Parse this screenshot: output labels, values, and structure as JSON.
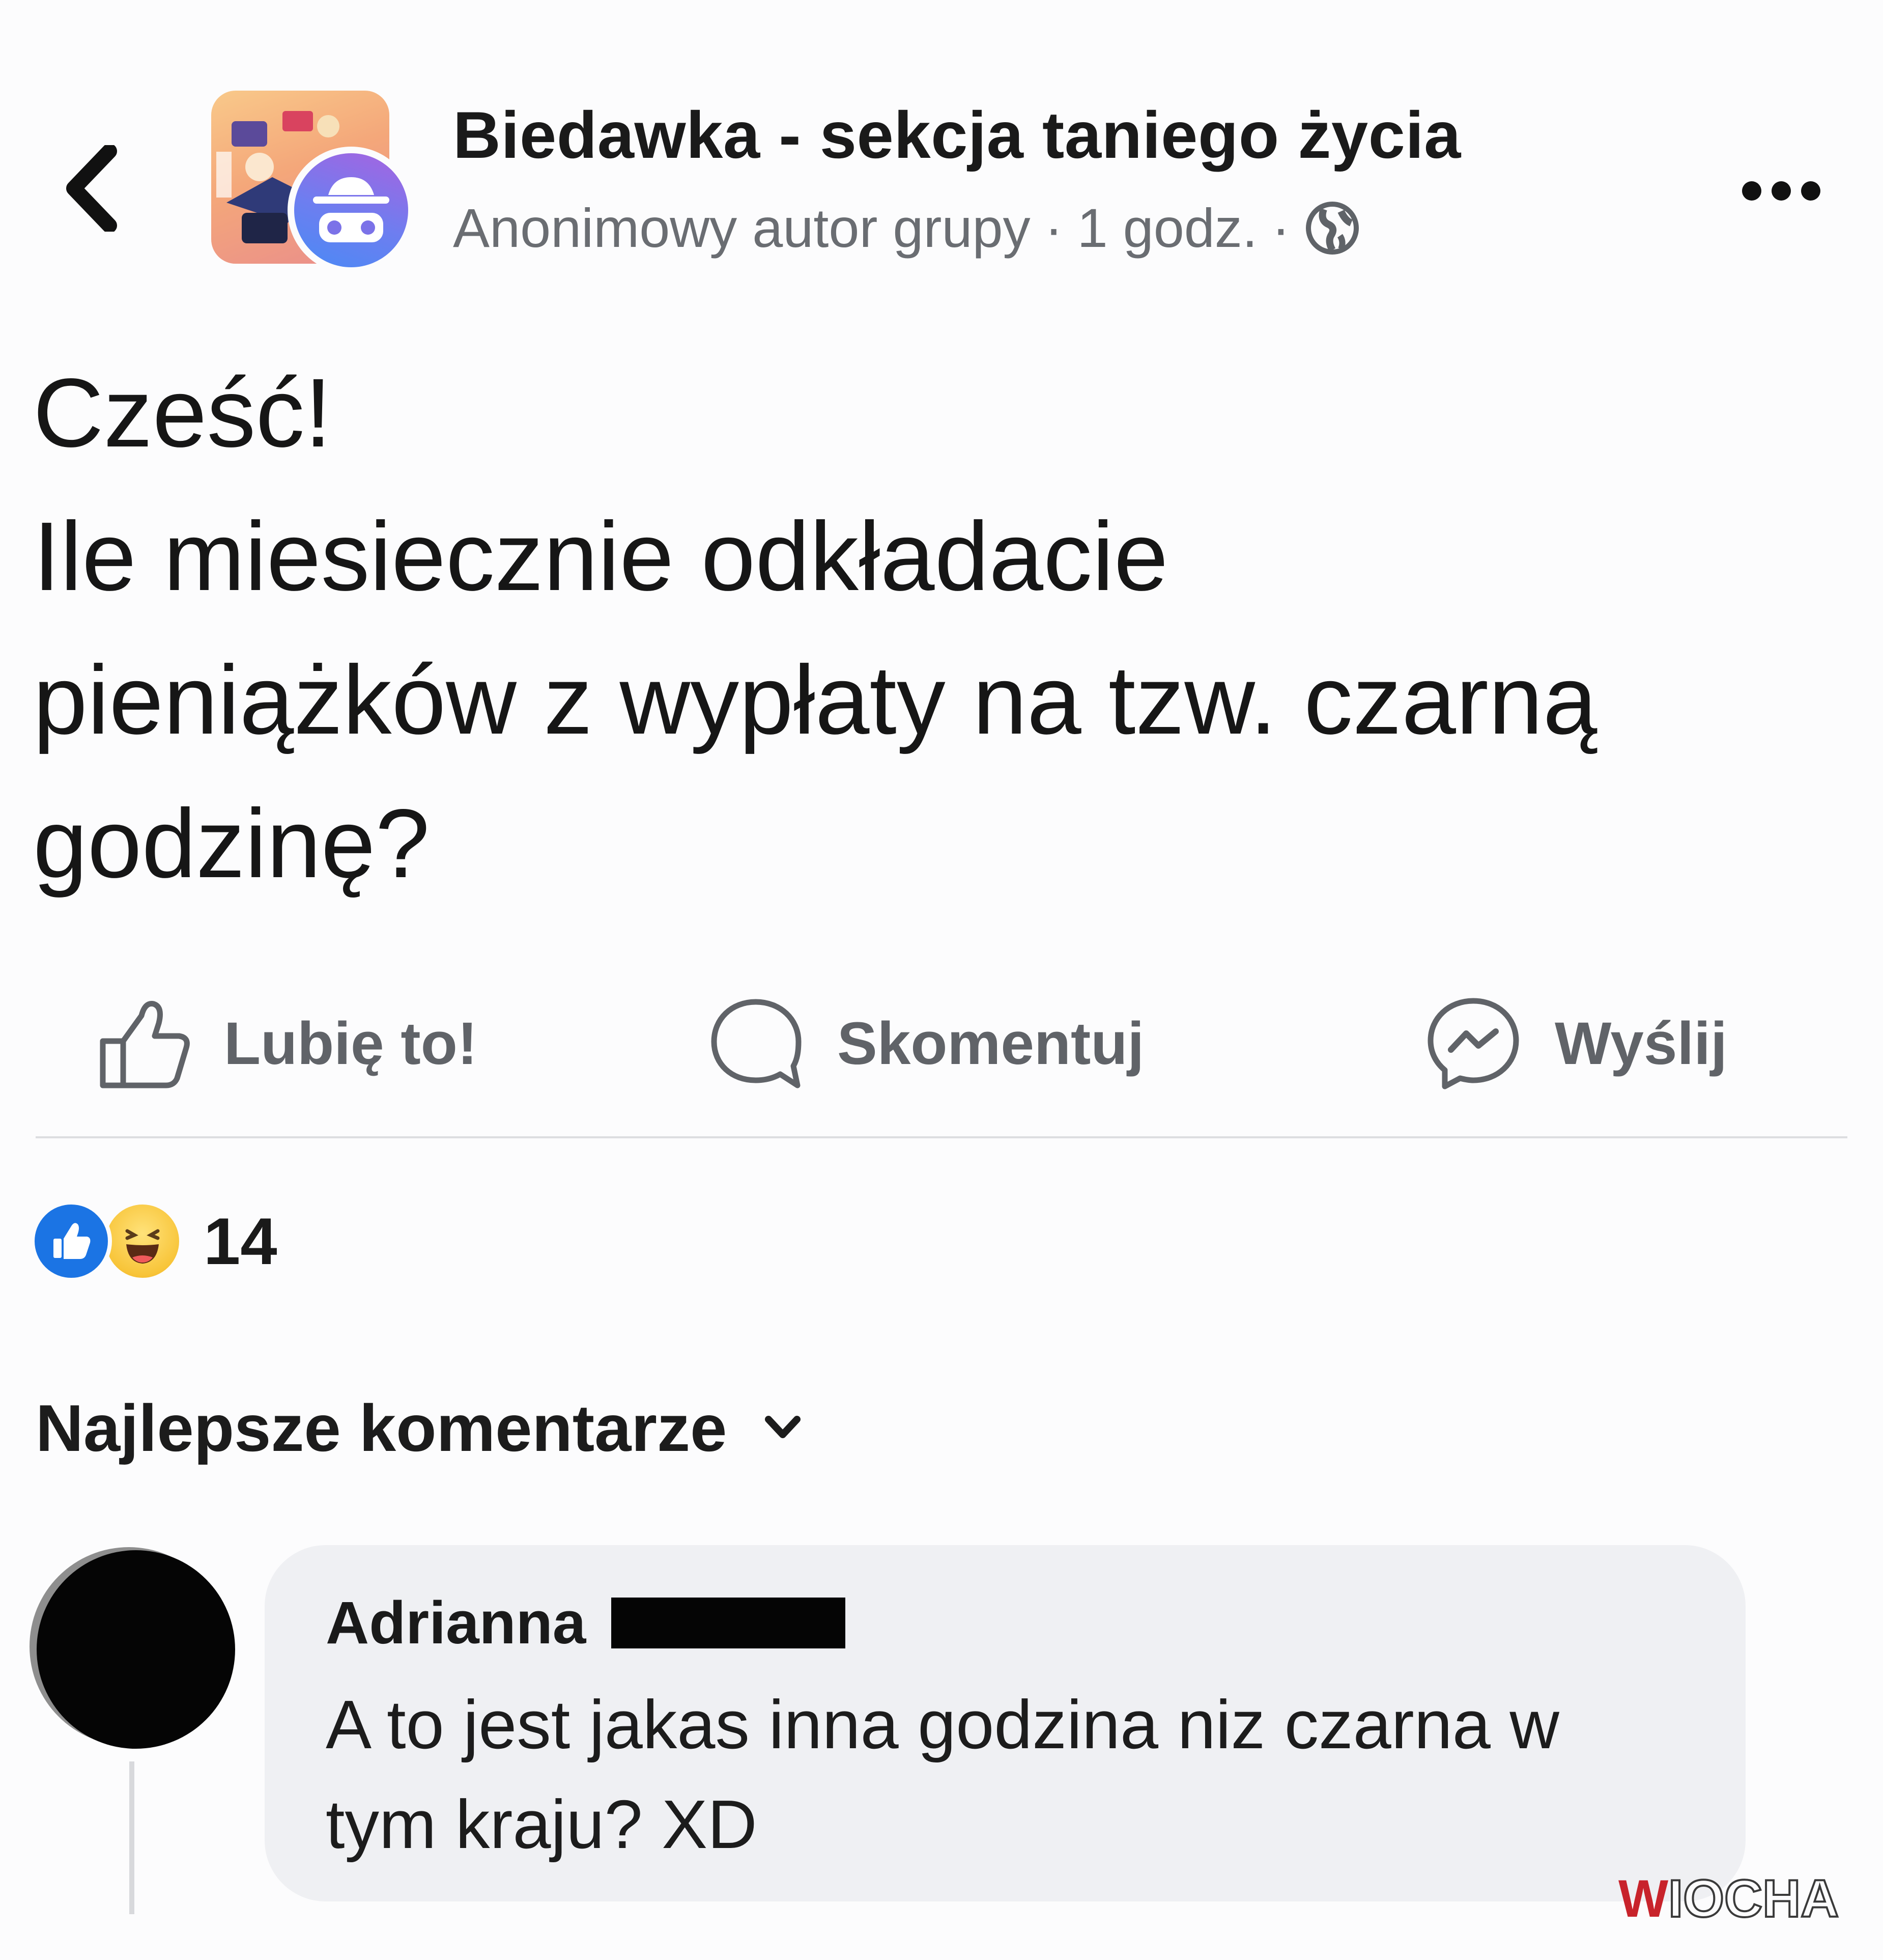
{
  "header": {
    "group_name": "Biedawka - sekcja taniego życia",
    "author": "Anonimowy autor grupy",
    "separator": "·",
    "time": "1 godz.",
    "audience_icon": "globe-icon",
    "back_icon": "chevron-left-icon",
    "more_icon": "more-dots-icon"
  },
  "post": {
    "lines": [
      "Cześć!",
      "Ile miesiecznie odkładacie",
      "pieniążków z wypłaty na tzw. czarną",
      "godzinę?"
    ]
  },
  "actions": {
    "like": "Lubię to!",
    "comment": "Skomentuj",
    "send": "Wyślij"
  },
  "reactions": {
    "icons": [
      "like-reaction-icon",
      "haha-reaction-icon"
    ],
    "count": "14"
  },
  "comments": {
    "sort_label": "Najlepsze komentarze",
    "items": [
      {
        "author": "Adrianna",
        "lines": [
          "A to jest jakas inna godzina niz czarna w",
          "tym kraju? XD"
        ]
      }
    ]
  },
  "watermark": {
    "first": "W",
    "rest": "IOCHA"
  },
  "colors": {
    "background": "#fcfcfd",
    "text": "#1b1b1b",
    "meta": "#6a6d72",
    "action": "#606368",
    "like_blue": "#1b74e4",
    "bubble": "#eff0f3",
    "watermark_red": "#c8232b"
  }
}
